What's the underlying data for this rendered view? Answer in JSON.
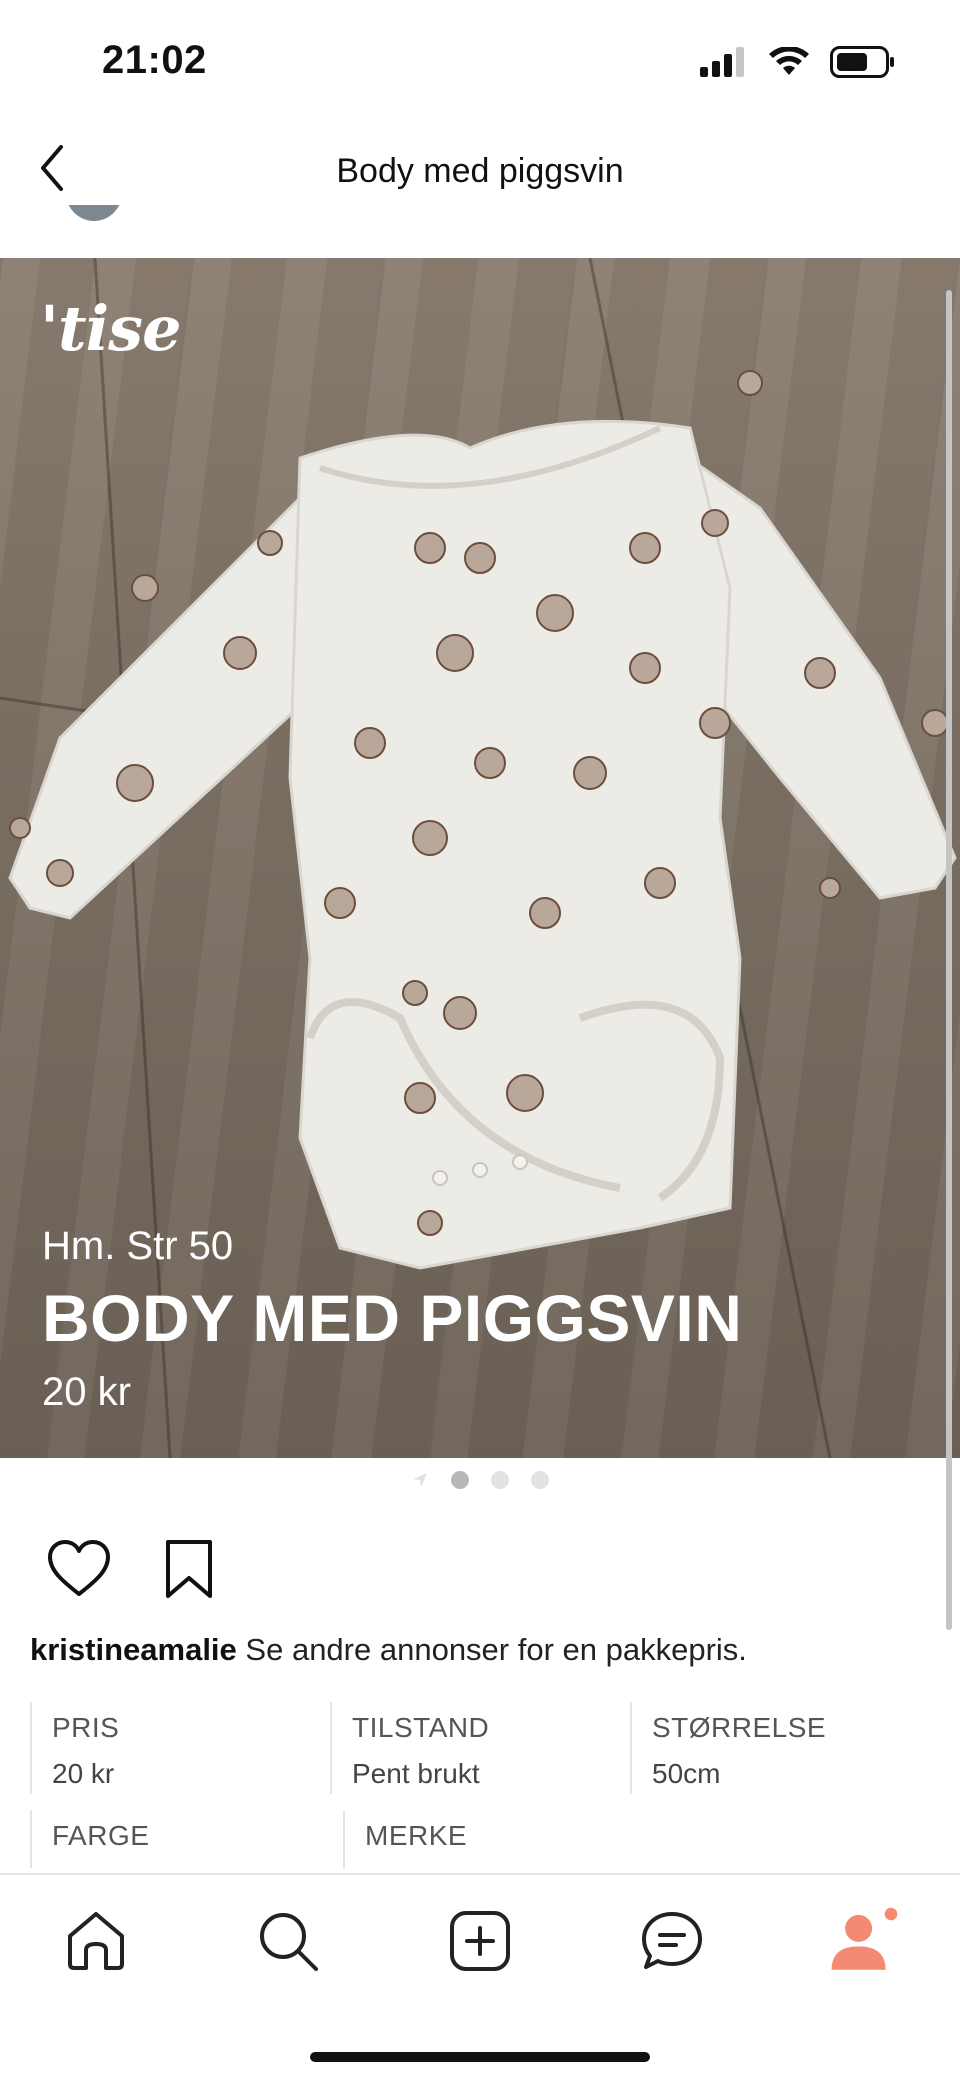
{
  "status": {
    "time": "21:02"
  },
  "nav": {
    "title": "Body med piggsvin"
  },
  "hero": {
    "logo": "'tise",
    "subtitle": "Hm. Str 50",
    "title": "BODY MED PIGGSVIN",
    "price": "20 kr",
    "image_count": 3,
    "active_index": 0
  },
  "caption": {
    "username": "kristineamalie",
    "text": "Se andre annonser for en pakkepris."
  },
  "details": [
    {
      "label": "PRIS",
      "value": "20 kr"
    },
    {
      "label": "TILSTAND",
      "value": "Pent brukt"
    },
    {
      "label": "STØRRELSE",
      "value": "50cm"
    },
    {
      "label": "FARGE",
      "value": ""
    },
    {
      "label": "MERKE",
      "value": ""
    }
  ],
  "colors": {
    "accent": "#f58a73",
    "text": "#111111",
    "muted": "#555555"
  },
  "icons": {
    "back": "chevron-left-icon",
    "like": "heart-icon",
    "save": "bookmark-icon",
    "home": "home-icon",
    "search": "search-icon",
    "add": "plus-square-icon",
    "messages": "chat-icon",
    "profile": "profile-icon"
  }
}
